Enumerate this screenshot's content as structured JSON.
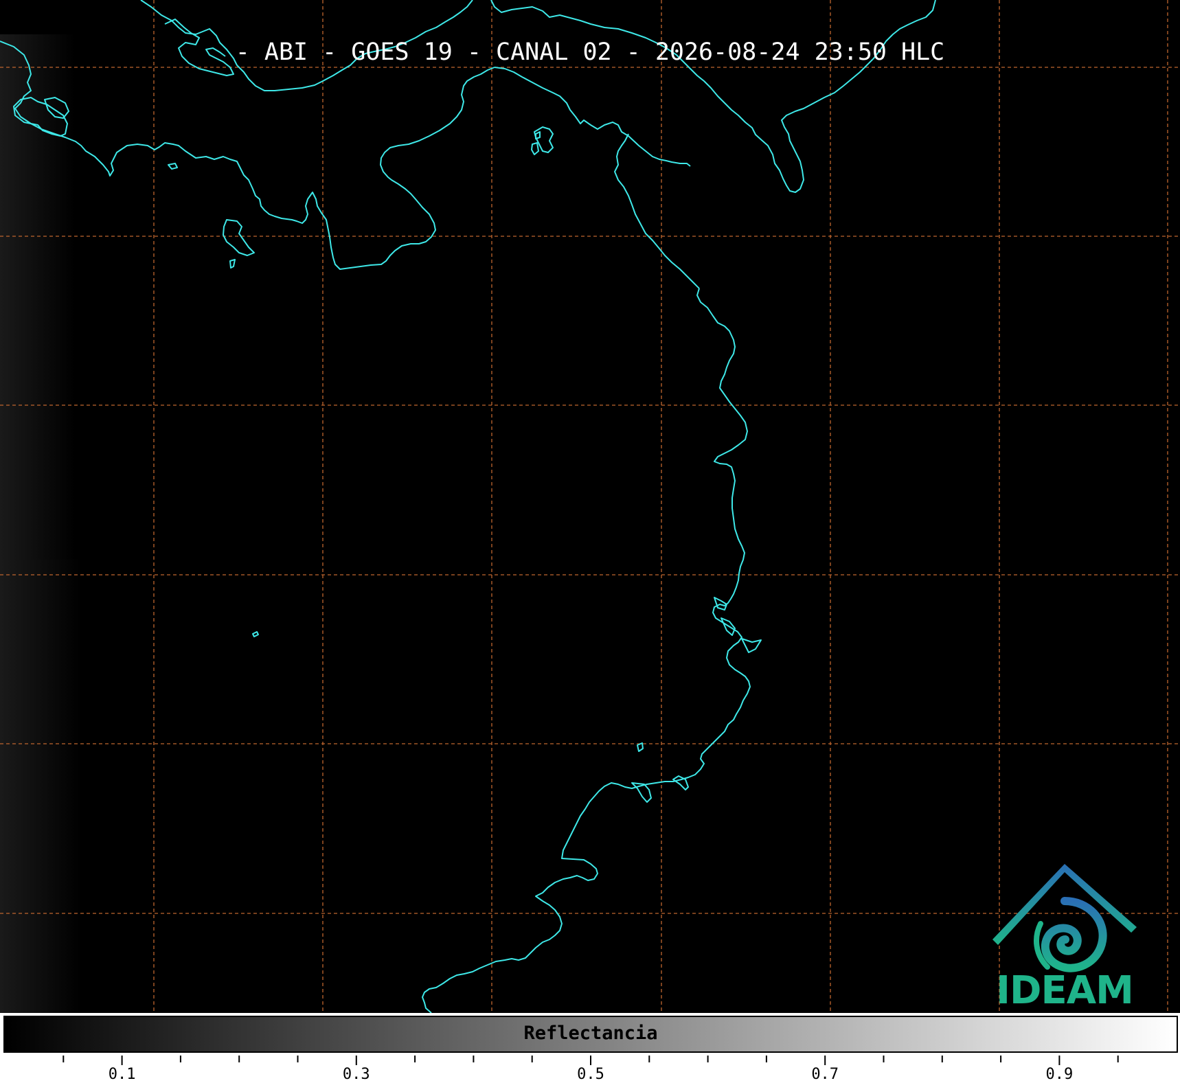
{
  "map": {
    "title": "- ABI - GOES 19 - CANAL 02 - 2026-08-24 23:50 HLC",
    "coastline_color": "#3ee8e8",
    "gridline_color": "#c0662f",
    "background_color": "#000000"
  },
  "logo": {
    "text": "IDEAM",
    "primary_color": "#1fb48a",
    "secondary_color": "#2a6fb5"
  },
  "colorbar": {
    "label": "Reflectancia",
    "range": [
      0.0,
      1.0
    ],
    "ticks": [
      "0.1",
      "0.3",
      "0.5",
      "0.7",
      "0.9"
    ],
    "colormap": "black-to-white"
  }
}
